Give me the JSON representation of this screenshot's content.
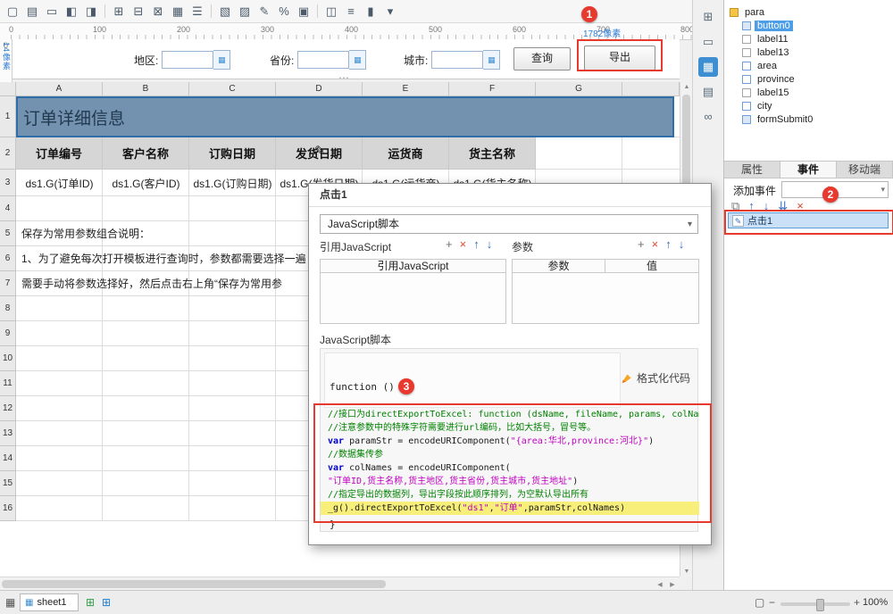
{
  "icons": {
    "chevron_down": "▾",
    "pencil": "✎",
    "dots_handle": "⋯",
    "scroll_up": "▲",
    "scroll_down": "▼",
    "scroll_left": "◀",
    "scroll_right": "▶",
    "plus": "+",
    "minus": "−",
    "zoom_plus": "+",
    "binding": "▦",
    "sheet_grid": "▦",
    "add_sheet": "⊞",
    "fit_window": "▢"
  },
  "toolbar": {
    "icons": [
      {
        "name": "new-template-icon",
        "glyph": "▢"
      },
      {
        "name": "page-setup-icon",
        "glyph": "▤"
      },
      {
        "name": "header-footer-icon",
        "glyph": "▭"
      },
      {
        "name": "merge-cells-icon",
        "glyph": "◧"
      },
      {
        "name": "unmerge-cells-icon",
        "glyph": "◨"
      },
      {
        "sep": true
      },
      {
        "name": "insert-row-icon",
        "glyph": "⊞"
      },
      {
        "name": "delete-row-icon",
        "glyph": "⊟"
      },
      {
        "name": "insert-cell-icon",
        "glyph": "⊠"
      },
      {
        "name": "cell-attribute-icon",
        "glyph": "▦"
      },
      {
        "name": "menu-icon",
        "glyph": "☰"
      },
      {
        "sep": true
      },
      {
        "name": "border-icon",
        "glyph": "▧"
      },
      {
        "name": "pattern-icon",
        "glyph": "▨"
      },
      {
        "name": "edit-icon",
        "glyph": "✎"
      },
      {
        "name": "percent-icon",
        "glyph": "%"
      },
      {
        "name": "widget-icon",
        "glyph": "▣"
      },
      {
        "sep": true
      },
      {
        "name": "split-view-icon",
        "glyph": "◫"
      },
      {
        "name": "list-icon",
        "glyph": "≡"
      },
      {
        "name": "cursor-icon",
        "glyph": "▮"
      },
      {
        "name": "more-dropdown-icon",
        "glyph": "▾"
      }
    ]
  },
  "ruler": {
    "h_numbers": [
      "0",
      "100",
      "200",
      "300",
      "400",
      "500",
      "600",
      "700",
      "800"
    ],
    "v_number": "0",
    "pane_height_hint": "14像素",
    "pane_width_hint": "1782像素"
  },
  "param_pane": {
    "fields": [
      {
        "label": "地区:"
      },
      {
        "label": "省份:"
      },
      {
        "label": "城市:"
      }
    ],
    "query_button": "查询",
    "export_button": "导出"
  },
  "sheet": {
    "columns": [
      "A",
      "B",
      "C",
      "D",
      "E",
      "F",
      "G"
    ],
    "row_numbers": [
      "1",
      "2",
      "3",
      "4",
      "5",
      "6",
      "7",
      "8",
      "9",
      "10",
      "11",
      "12",
      "13",
      "14",
      "15",
      "16"
    ],
    "title_cell": "订单详细信息",
    "header_cells": [
      "订单编号",
      "客户名称",
      "订购日期",
      "发货日期",
      "运货商",
      "货主名称"
    ],
    "formula_cells": [
      "ds1.G(订单ID)",
      "ds1.G(客户ID)",
      "ds1.G(订购日期)",
      "ds1.G(发货日期)",
      "ds1.G(运货商)",
      "ds1.G(货主名称)"
    ],
    "note_lines": [
      "保存为常用参数组合说明：",
      "1、为了避免每次打开模板进行查询时，参数都需要选择一遍",
      "需要手动将参数选择好，然后点击右上角“保存为常用参"
    ]
  },
  "dialog": {
    "title": "点击1",
    "event_type_value": "JavaScript脚本",
    "ref_js_label": "引用JavaScript",
    "params_label": "参数",
    "ref_js_table_header": "引用JavaScript",
    "param_col_header": "参数",
    "value_col_header": "值",
    "script_section_label": "JavaScript脚本",
    "function_open": "function () {",
    "function_close": "}",
    "format_code_label": "格式化代码",
    "list_buttons": [
      {
        "name": "add-icon",
        "glyph": "+",
        "color": "#6f6f6f"
      },
      {
        "name": "delete-icon",
        "glyph": "×",
        "color": "#e0492f"
      },
      {
        "name": "move-up-icon",
        "glyph": "↑",
        "color": "#3a6fc4"
      },
      {
        "name": "move-down-icon",
        "glyph": "↓",
        "color": "#3a6fc4"
      }
    ],
    "code_lines": [
      {
        "segments": [
          {
            "style": "comment",
            "text": "//接口为directExportToExcel: function (dsName, fileName, params, colNames)"
          }
        ]
      },
      {
        "segments": [
          {
            "style": "comment",
            "text": "//注意参数中的特殊字符需要进行url编码，比如大括号，冒号等。"
          }
        ]
      },
      {
        "segments": [
          {
            "style": "keyword",
            "text": "var"
          },
          {
            "style": "plain",
            "text": " paramStr = encodeURIComponent("
          },
          {
            "style": "string",
            "text": "\"{area:华北,province:河北}\""
          },
          {
            "style": "plain",
            "text": ")"
          }
        ]
      },
      {
        "segments": [
          {
            "style": "comment",
            "text": "//数据集传参"
          }
        ]
      },
      {
        "segments": [
          {
            "style": "keyword",
            "text": "var"
          },
          {
            "style": "plain",
            "text": " colNames = encodeURIComponent("
          }
        ]
      },
      {
        "segments": [
          {
            "style": "string",
            "text": "\"订单ID,货主名称,货主地区,货主省份,货主城市,货主地址\""
          },
          {
            "style": "plain",
            "text": ")"
          }
        ]
      },
      {
        "segments": [
          {
            "style": "comment",
            "text": "//指定导出的数据列，导出字段按此顺序排列，为空默认导出所有"
          }
        ]
      },
      {
        "highlight": true,
        "segments": [
          {
            "style": "plain",
            "text": "_g().directExportToExcel("
          },
          {
            "style": "string",
            "text": "\"ds1\""
          },
          {
            "style": "plain",
            "text": ","
          },
          {
            "style": "string",
            "text": "\"订单\""
          },
          {
            "style": "plain",
            "text": ",paramStr,colNames)"
          }
        ]
      }
    ]
  },
  "side_strip": {
    "icons": [
      {
        "name": "template-settings-icon",
        "glyph": "⊞",
        "active": false
      },
      {
        "name": "component-library-icon",
        "glyph": "▭",
        "active": false
      },
      {
        "name": "cell-element-icon",
        "glyph": "▦",
        "active": true
      },
      {
        "name": "condition-display-icon",
        "glyph": "▤",
        "active": false
      },
      {
        "name": "hyperlink-icon",
        "glyph": "∞",
        "active": false
      }
    ]
  },
  "sidebar": {
    "tree": [
      {
        "label": "para",
        "type": "folder",
        "indent": 0,
        "selected": false
      },
      {
        "label": "button0",
        "type": "button",
        "indent": 1,
        "selected": true
      },
      {
        "label": "label11",
        "type": "label",
        "indent": 1,
        "selected": false
      },
      {
        "label": "label13",
        "type": "label",
        "indent": 1,
        "selected": false
      },
      {
        "label": "area",
        "type": "input",
        "indent": 1,
        "selected": false
      },
      {
        "label": "province",
        "type": "input",
        "indent": 1,
        "selected": false
      },
      {
        "label": "label15",
        "type": "label",
        "indent": 1,
        "selected": false
      },
      {
        "label": "city",
        "type": "input",
        "indent": 1,
        "selected": false
      },
      {
        "label": "formSubmit0",
        "type": "button",
        "indent": 1,
        "selected": false
      }
    ],
    "tabs": [
      {
        "label": "属性",
        "name": "tab-properties",
        "active": false
      },
      {
        "label": "事件",
        "name": "tab-events",
        "active": true
      },
      {
        "label": "移动端",
        "name": "tab-mobile",
        "active": false
      }
    ],
    "add_event_label": "添加事件",
    "event_toolbar": [
      {
        "name": "copy-event-icon",
        "glyph": "⧉",
        "color": "#777777"
      },
      {
        "name": "move-up-icon",
        "glyph": "↑",
        "color": "#3a6fc4"
      },
      {
        "name": "move-down-icon",
        "glyph": "↓",
        "color": "#3a6fc4"
      },
      {
        "name": "move-to-bottom-icon",
        "glyph": "⇊",
        "color": "#3a6fc4"
      },
      {
        "name": "delete-event-icon",
        "glyph": "×",
        "color": "#d9452c"
      }
    ],
    "event_item": "点击1"
  },
  "statusbar": {
    "sheet_tab": "sheet1",
    "zoom_value": "100%"
  },
  "annotations": {
    "step1": "1",
    "step2": "2",
    "step3": "3"
  },
  "colors": {
    "accent": "#3d8fd1",
    "annotation": "#e8392e",
    "selection_border": "#2f6da9",
    "title_cell_bg": "#7292b0",
    "highlight_line": "#f7ef7a"
  }
}
